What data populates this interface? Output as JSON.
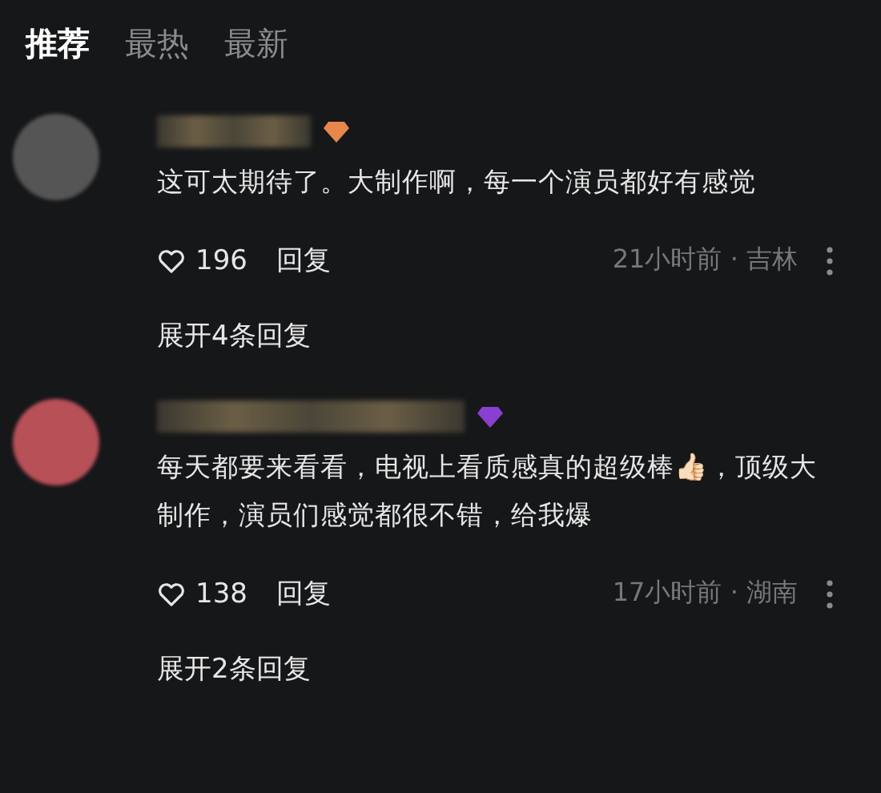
{
  "tabs": [
    {
      "label": "推荐",
      "selected": true
    },
    {
      "label": "最热",
      "selected": false
    },
    {
      "label": "最新",
      "selected": false
    }
  ],
  "comments": [
    {
      "badge": {
        "color": "#e8874a"
      },
      "text": "这可太期待了。大制作啊，每一个演员都好有感觉",
      "likes": "196",
      "reply": "回复",
      "meta": "21小时前 · 吉林",
      "expand": "展开4条回复"
    },
    {
      "badge": {
        "color": "#8a3fd0"
      },
      "text": "每天都要来看看，电视上看质感真的超级棒👍🏻，顶级大制作，演员们感觉都很不错，给我爆",
      "likes": "138",
      "reply": "回复",
      "meta": "17小时前 · 湖南",
      "expand": "展开2条回复"
    }
  ]
}
